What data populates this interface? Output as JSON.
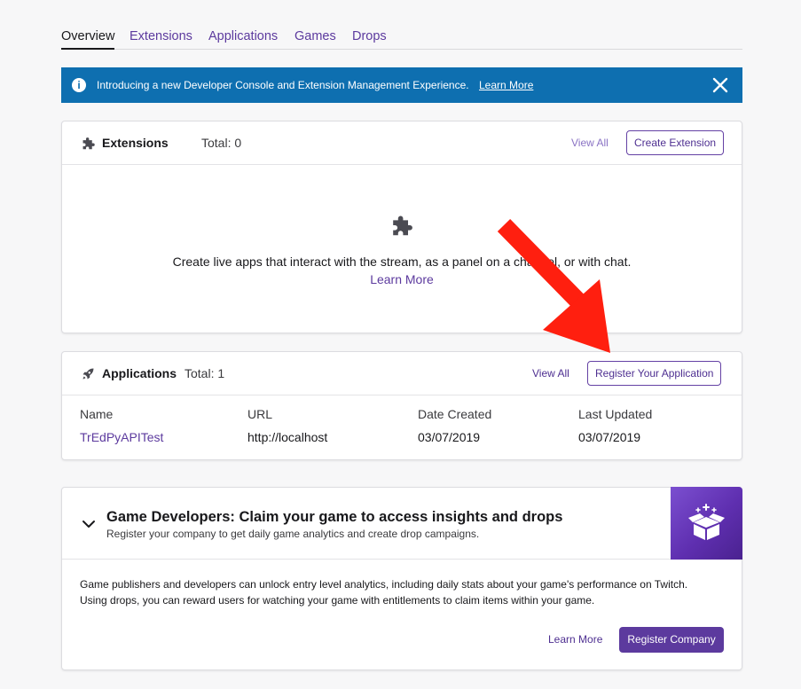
{
  "tabs": [
    {
      "label": "Overview",
      "active": true
    },
    {
      "label": "Extensions"
    },
    {
      "label": "Applications"
    },
    {
      "label": "Games"
    },
    {
      "label": "Drops"
    }
  ],
  "banner": {
    "text": "Introducing a new Developer Console and Extension Management Experience.",
    "link": "Learn More",
    "icon": "info-icon",
    "close_icon": "close-icon",
    "color": "#0e6fb0"
  },
  "extensions": {
    "title": "Extensions",
    "total": "Total: 0",
    "view_all": "View All",
    "create_button": "Create Extension",
    "icon": "puzzle-icon",
    "description": "Create live apps that interact with the stream, as a panel on a channel, or with chat.",
    "learn_more": "Learn More"
  },
  "applications": {
    "title": "Applications",
    "total": "Total: 1",
    "view_all": "View All",
    "register_button": "Register Your Application",
    "icon": "rocket-icon",
    "columns": [
      "Name",
      "URL",
      "Date Created",
      "Last Updated"
    ],
    "rows": [
      {
        "name": "TrEdPyAPITest",
        "url": "http://localhost",
        "date_created": "03/07/2019",
        "last_updated": "03/07/2019"
      }
    ]
  },
  "game_developers": {
    "title": "Game Developers: Claim your game to access insights and drops",
    "subtitle": "Register your company to get daily game analytics and create drop campaigns.",
    "body_line1": "Game publishers and developers can unlock entry level analytics, including daily stats about your game's performance on Twitch.",
    "body_line2": "Using drops, you can reward users for watching your game with entitlements to claim items within your game.",
    "learn_more": "Learn More",
    "register_button": "Register Company",
    "icon": "gift-box-icon",
    "chevron_icon": "chevron-down-icon"
  },
  "colors": {
    "accent": "#5c3a9e",
    "annotation_arrow": "#ff1f0f"
  }
}
